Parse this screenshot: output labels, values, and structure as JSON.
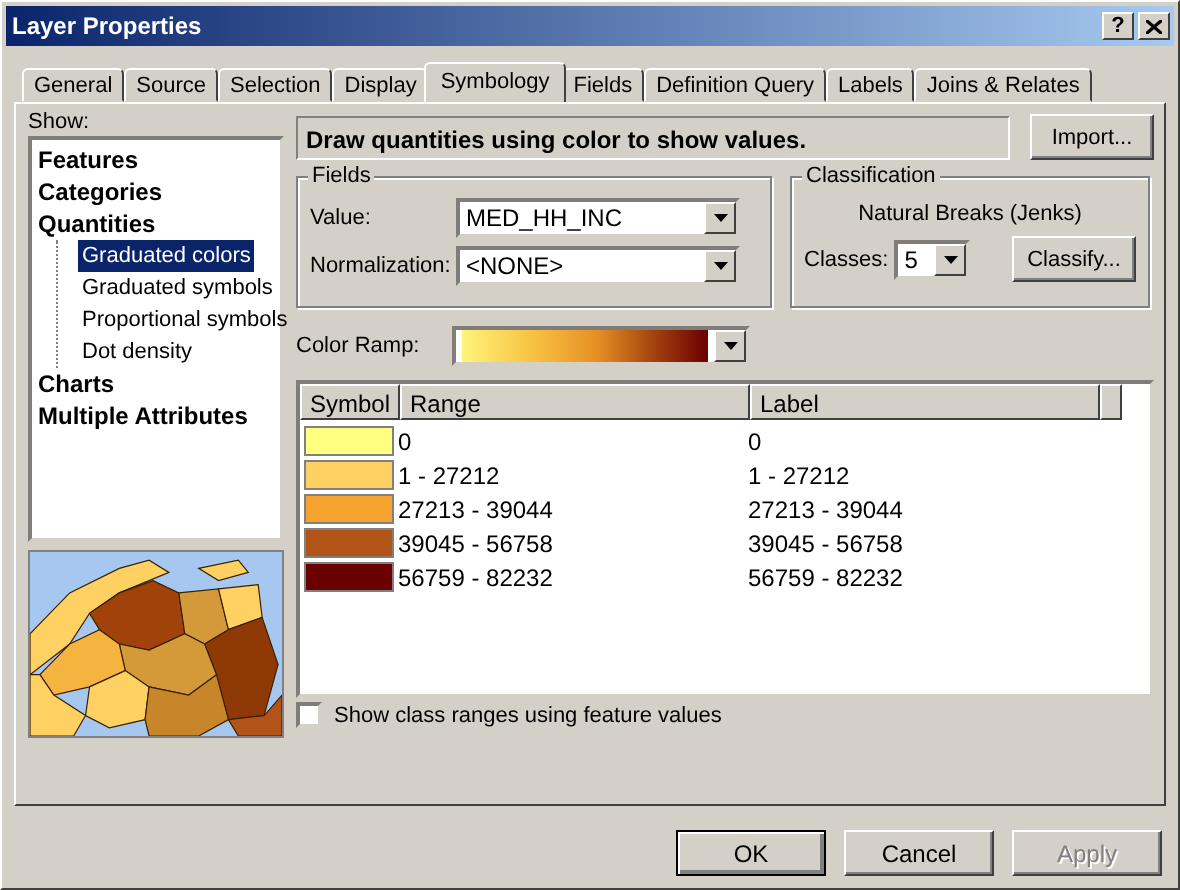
{
  "window": {
    "title": "Layer Properties",
    "help_button": "?"
  },
  "tabs": [
    {
      "label": "General",
      "selected": false
    },
    {
      "label": "Source",
      "selected": false
    },
    {
      "label": "Selection",
      "selected": false
    },
    {
      "label": "Display",
      "selected": false
    },
    {
      "label": "Symbology",
      "selected": true
    },
    {
      "label": "Fields",
      "selected": false
    },
    {
      "label": "Definition Query",
      "selected": false
    },
    {
      "label": "Labels",
      "selected": false
    },
    {
      "label": "Joins & Relates",
      "selected": false
    }
  ],
  "show": {
    "label": "Show:",
    "items": [
      {
        "label": "Features",
        "selected": false
      },
      {
        "label": "Categories",
        "selected": false
      },
      {
        "label": "Quantities",
        "selected": false,
        "children": [
          {
            "label": "Graduated colors",
            "selected": true
          },
          {
            "label": "Graduated symbols",
            "selected": false
          },
          {
            "label": "Proportional symbols",
            "selected": false
          },
          {
            "label": "Dot density",
            "selected": false
          }
        ]
      },
      {
        "label": "Charts",
        "selected": false
      },
      {
        "label": "Multiple Attributes",
        "selected": false
      }
    ]
  },
  "description": "Draw quantities using color to show values.",
  "import_button": "Import...",
  "fields": {
    "title": "Fields",
    "value_label": "Value:",
    "value": "MED_HH_INC",
    "normalization_label": "Normalization:",
    "normalization": "<NONE>"
  },
  "classification": {
    "title": "Classification",
    "method": "Natural Breaks (Jenks)",
    "classes_label": "Classes:",
    "classes": "5",
    "classify_button": "Classify..."
  },
  "color_ramp": {
    "label": "Color Ramp:"
  },
  "table": {
    "columns": [
      "Symbol",
      "Range",
      "Label"
    ],
    "rows": [
      {
        "color": "#ffff80",
        "range": "0",
        "label": "0"
      },
      {
        "color": "#fed162",
        "range": "1 - 27212",
        "label": "1 - 27212"
      },
      {
        "color": "#f5a32e",
        "range": "27213 - 39044",
        "label": "27213 - 39044"
      },
      {
        "color": "#b25417",
        "range": "39045 - 56758",
        "label": "39045 - 56758"
      },
      {
        "color": "#6b0000",
        "range": "56759 - 82232",
        "label": "56759 - 82232"
      }
    ]
  },
  "feature_ranges": {
    "label": "Show class ranges using feature values",
    "checked": false
  },
  "buttons": [
    {
      "label": "OK",
      "disabled": false
    },
    {
      "label": "Cancel",
      "disabled": false
    },
    {
      "label": "Apply",
      "disabled": true
    }
  ]
}
